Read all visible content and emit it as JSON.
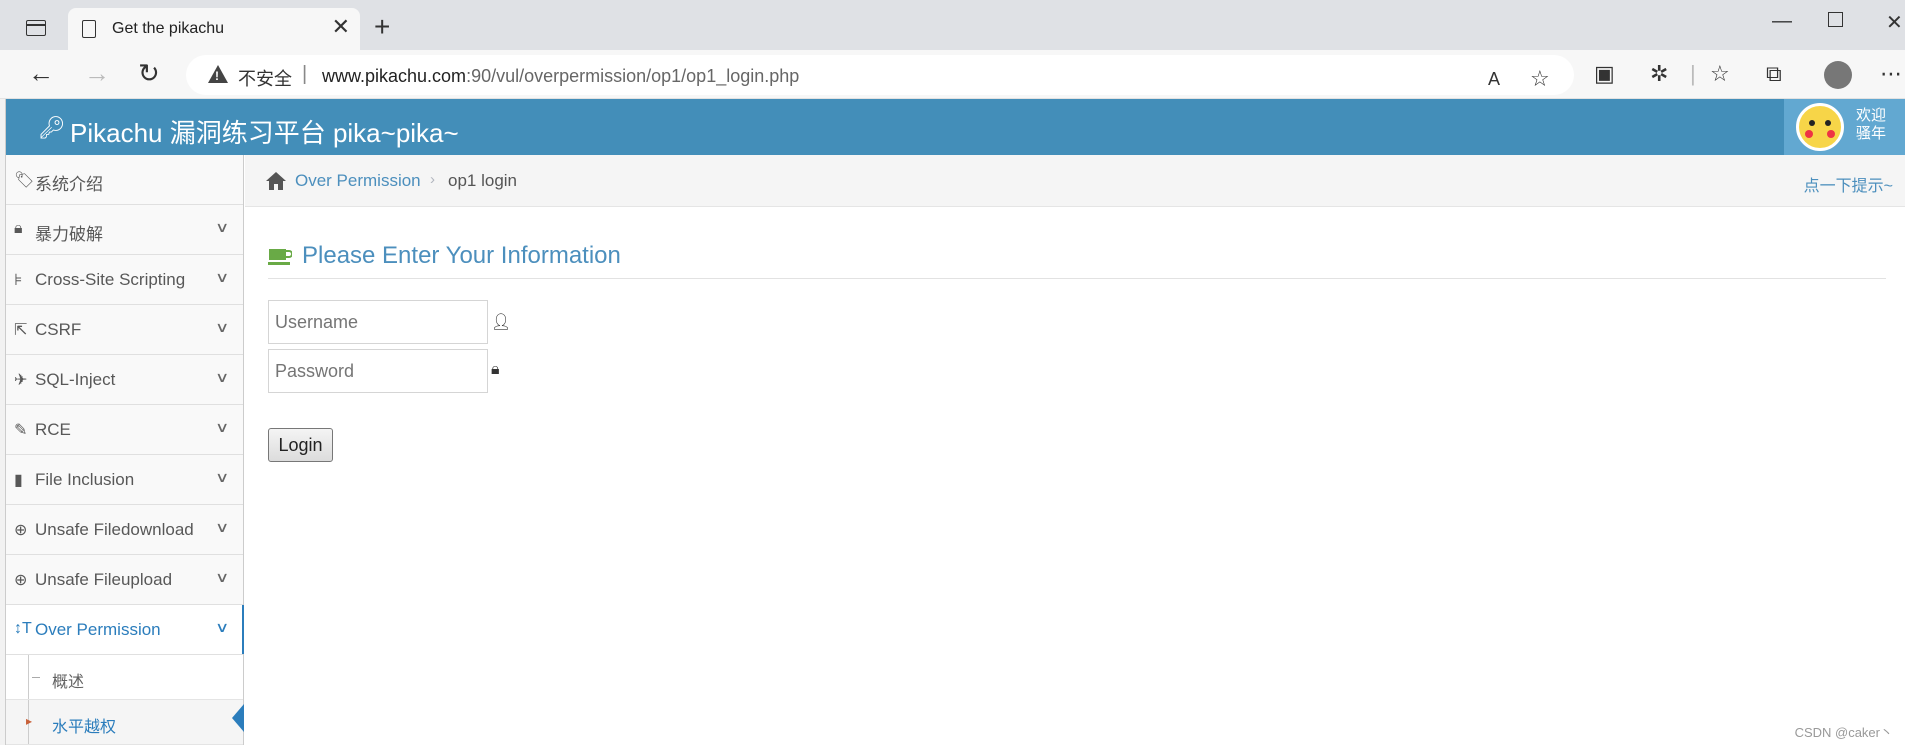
{
  "browser": {
    "tab_title": "Get the pikachu",
    "insecure_label": "不安全",
    "url_host": "www.pikachu.com",
    "url_rest": ":90/vul/overpermission/op1/op1_login.php"
  },
  "header": {
    "title": "Pikachu 漏洞练习平台 pika~pika~",
    "welcome_line1": "欢迎",
    "welcome_line2": "骚年"
  },
  "sidebar": {
    "items": [
      {
        "label": "系统介绍"
      },
      {
        "label": "暴力破解"
      },
      {
        "label": "Cross-Site Scripting"
      },
      {
        "label": "CSRF"
      },
      {
        "label": "SQL-Inject"
      },
      {
        "label": "RCE"
      },
      {
        "label": "File Inclusion"
      },
      {
        "label": "Unsafe Filedownload"
      },
      {
        "label": "Unsafe Fileupload"
      },
      {
        "label": "Over Permission"
      }
    ],
    "sub_items": [
      {
        "label": "概述"
      },
      {
        "label": "水平越权"
      }
    ]
  },
  "breadcrumb": {
    "parent": "Over Permission",
    "current": "op1 login",
    "hint": "点一下提示~"
  },
  "form": {
    "title": "Please Enter Your Information",
    "username_placeholder": "Username",
    "password_placeholder": "Password",
    "login_label": "Login"
  },
  "watermark": "CSDN @caker丶"
}
